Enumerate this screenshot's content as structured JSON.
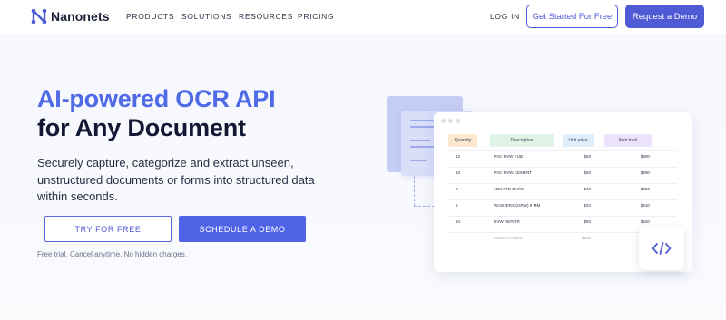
{
  "nav": {
    "brand": "Nanonets",
    "links": [
      "PRODUCTS",
      "SOLUTIONS",
      "RESOURCES",
      "PRICING"
    ],
    "login": "LOG IN",
    "get_started": "Get Started For Free",
    "request_demo": "Request a Demo"
  },
  "hero": {
    "title_line1": "AI-powered OCR API",
    "title_line2": "for Any Document",
    "subtitle": "Securely capture, categorize and extract unseen, unstructured documents or forms into structured data within seconds.",
    "try_button": "TRY FOR FREE",
    "demo_button": "SCHEDULE A DEMO",
    "note": "Free trial. Cancel anytime. No hidden charges."
  },
  "table": {
    "headers": [
      "Quantity",
      "Description",
      "Unit price",
      "Item total"
    ],
    "rows": [
      [
        "12",
        "PVC DVW YUB",
        "$50",
        "$600"
      ],
      [
        "10",
        "PVC DVW CEMENT",
        "$60",
        "$250"
      ],
      [
        "8",
        "12M STE BARS",
        "$48",
        "$320"
      ],
      [
        "5",
        "WASHERS (GRW) 5 MM",
        "$32",
        "$610"
      ],
      [
        "10",
        "DVW REPAIR",
        "$50",
        "$520"
      ],
      [
        "",
        "INSTALLATION",
        "$100",
        "$500"
      ]
    ]
  },
  "colors": {
    "brand": "#4f5bd5",
    "title_accent": "#4f6ae6",
    "hdr_quantity": "#fbe8cf",
    "hdr_description": "#dff3e6",
    "hdr_unit_price": "#dfeefb",
    "hdr_item_total": "#ece2fa"
  },
  "icons": {
    "logo": "nanonets-logo-icon",
    "code": "code-brackets-icon"
  }
}
